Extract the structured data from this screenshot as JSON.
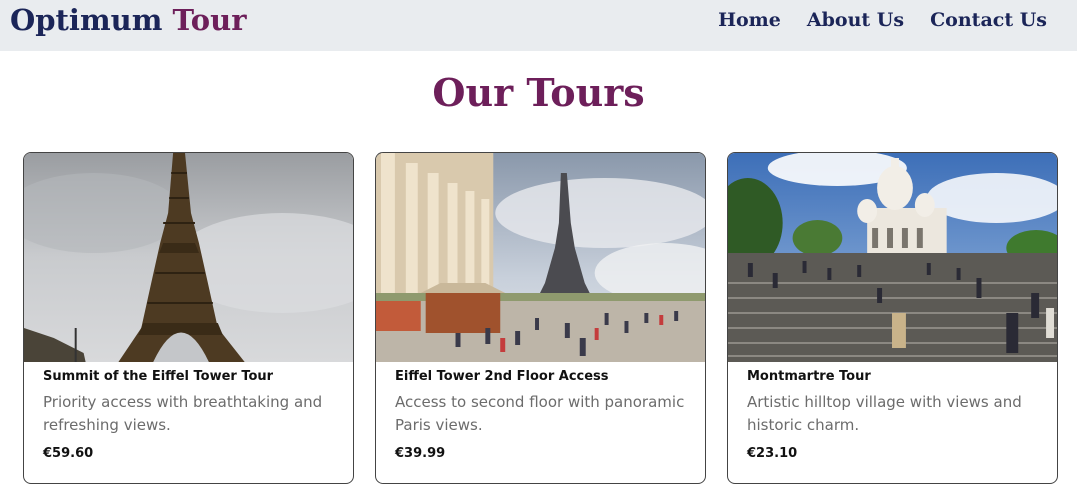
{
  "brand": {
    "part1": "Optimum",
    "part2": "Tour"
  },
  "nav": {
    "items": [
      "Home",
      "About Us",
      "Contact Us"
    ]
  },
  "page_title": "Our Tours",
  "tours": [
    {
      "name": "Summit of the Eiffel Tower Tour",
      "description": "Priority access with breathtaking and refreshing views.",
      "price": "€59.60",
      "image": "eiffel-tower-closeup-photo"
    },
    {
      "name": "Eiffel Tower 2nd Floor Access",
      "description": "Access to second floor with panoramic Paris views.",
      "price": "€39.99",
      "image": "eiffel-tower-trocadero-photo"
    },
    {
      "name": "Montmartre Tour",
      "description": "Artistic hilltop village with views and historic charm.",
      "price": "€23.10",
      "image": "sacre-coeur-montmartre-photo"
    }
  ]
}
